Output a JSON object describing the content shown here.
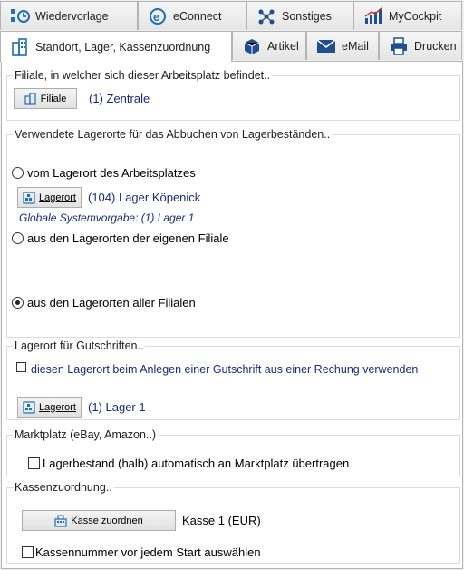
{
  "tabs_row1": [
    {
      "label": "Wiedervorlage",
      "icon": "wiedervorlage-icon"
    },
    {
      "label": "eConnect",
      "icon": "econnect-icon"
    },
    {
      "label": "Sonstiges",
      "icon": "sonstiges-icon"
    },
    {
      "label": "MyCockpit",
      "icon": "mycockpit-icon"
    }
  ],
  "tabs_row2": [
    {
      "label": "Standort, Lager, Kassenzuordnung",
      "icon": "building-icon",
      "active": true
    },
    {
      "label": "Artikel",
      "icon": "box-icon"
    },
    {
      "label": "eMail",
      "icon": "mail-icon"
    },
    {
      "label": "Drucken",
      "icon": "printer-icon"
    }
  ],
  "filiale": {
    "legend": "Filiale, in welcher sich dieser Arbeitsplatz befindet..",
    "button_label": "Filiale",
    "value": "(1) Zentrale"
  },
  "lagerorte": {
    "legend": "Verwendete Lagerorte für das Abbuchen von Lagerbeständen..",
    "radio1_label": "vom Lagerort des Arbeitsplatzes",
    "button_label": "Lagerort",
    "value": "(104) Lager Köpenick",
    "note": "Globale Systemvorgabe: (1) Lager 1",
    "radio2_label": "aus den Lagerorten der eigenen Filiale",
    "radio3_label": "aus den Lagerorten aller Filialen",
    "selected": 3
  },
  "gutschriften": {
    "legend": "Lagerort für Gutschriften..",
    "checkbox_label": "diesen Lagerort beim Anlegen einer Gutschrift aus einer Rechung verwenden",
    "button_label": "Lagerort",
    "value": "(1) Lager 1"
  },
  "marktplatz": {
    "legend": "Marktplatz (eBay, Amazon..)",
    "checkbox_label": "Lagerbestand (halb) automatisch an Marktplatz übertragen"
  },
  "kasse": {
    "legend": "Kassenzuordnung..",
    "button_label": "Kasse zuordnen",
    "value": "Kasse 1 (EUR)",
    "checkbox_label": "Kassennummer vor jedem Start auswählen"
  },
  "colors": {
    "link": "#1b2a7a",
    "accent_blue": "#1f6fb5"
  }
}
